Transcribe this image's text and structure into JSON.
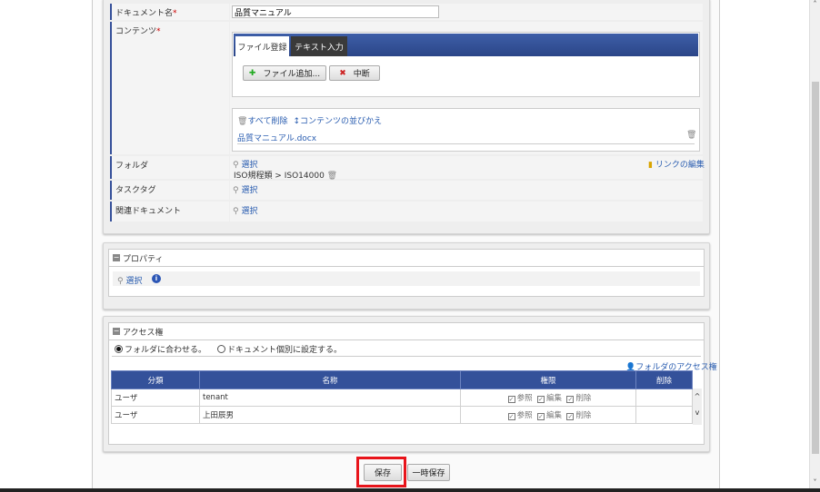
{
  "form": {
    "doc_name_label": "ドキュメント名",
    "required": "*",
    "doc_name_value": "品質マニュアル",
    "contents_label": "コンテンツ",
    "tabs": [
      "ファイル登録",
      "テキスト入力"
    ],
    "add_file": "ファイル追加...",
    "cancel": "中断",
    "delete_all": "すべて削除",
    "reorder": "コンテンツの並びかえ",
    "file_name": "品質マニュアル.docx",
    "folder_label": "フォルダ",
    "select": "選択",
    "folder_path": "ISO規程類 > ISO14000",
    "edit_link": "リンクの編集",
    "tasktag_label": "タスクタグ",
    "related_label": "関連ドキュメント"
  },
  "properties": {
    "title": "プロパティ",
    "select": "選択"
  },
  "access": {
    "title": "アクセス権",
    "option_folder": "フォルダに合わせる。",
    "option_individual": "ドキュメント個別に設定する。",
    "selected": "folder",
    "folder_access_link": "フォルダのアクセス権",
    "columns": [
      "分類",
      "名称",
      "権限",
      "削除"
    ],
    "rows": [
      {
        "type": "ユーザ",
        "name": "tenant",
        "perms": [
          "参照",
          "編集",
          "削除"
        ]
      },
      {
        "type": "ユーザ",
        "name": "上田辰男",
        "perms": [
          "参照",
          "編集",
          "削除"
        ]
      }
    ]
  },
  "footer": {
    "save": "保存",
    "temp_save": "一時保存"
  },
  "colors": {
    "accent": "#34519a",
    "highlight": "#e8141b"
  }
}
